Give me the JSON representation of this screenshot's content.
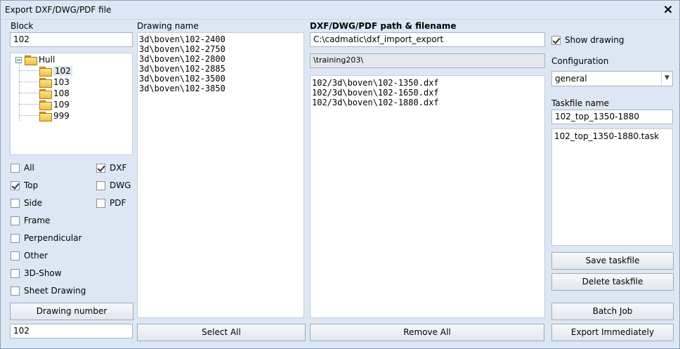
{
  "window": {
    "title": "Export DXF/DWG/PDF file",
    "close_label": "×"
  },
  "block": {
    "label": "Block",
    "value": "102",
    "tree": {
      "root": "Hull",
      "children": [
        "102",
        "103",
        "108",
        "109",
        "999"
      ]
    }
  },
  "filters": {
    "views": [
      {
        "label": "All",
        "checked": false
      },
      {
        "label": "Top",
        "checked": true
      },
      {
        "label": "Side",
        "checked": false
      },
      {
        "label": "Frame",
        "checked": false
      },
      {
        "label": "Perpendicular",
        "checked": false
      },
      {
        "label": "Other",
        "checked": false
      },
      {
        "label": "3D-Show",
        "checked": false
      },
      {
        "label": "Sheet Drawing",
        "checked": false
      }
    ],
    "formats": [
      {
        "label": "DXF",
        "checked": true
      },
      {
        "label": "DWG",
        "checked": false
      },
      {
        "label": "PDF",
        "checked": false
      }
    ]
  },
  "drawing_number": {
    "button_label": "Drawing number",
    "value": "102"
  },
  "drawing_name": {
    "label": "Drawing name",
    "items": [
      "3d\\boven\\102-2400",
      "3d\\boven\\102-2750",
      "3d\\boven\\102-2800",
      "3d\\boven\\102-2885",
      "3d\\boven\\102-3500",
      "3d\\boven\\102-3850"
    ],
    "select_all_label": "Select All"
  },
  "path": {
    "label": "DXF/DWG/PDF path & filename",
    "value": "C:\\cadmatic\\dxf_import_export",
    "subpath": "\\training203\\",
    "files": [
      "102/3d\\boven\\102-1350.dxf",
      "102/3d\\boven\\102-1650.dxf",
      "102/3d\\boven\\102-1880.dxf"
    ],
    "remove_all_label": "Remove All"
  },
  "right": {
    "show_drawing_label": "Show drawing",
    "show_drawing_checked": true,
    "configuration_label": "Configuration",
    "configuration_value": "general",
    "taskfile_label": "Taskfile name",
    "taskfile_value": "102_top_1350-1880",
    "taskfiles": [
      "102_top_1350-1880.task"
    ],
    "save_label": "Save taskfile",
    "delete_label": "Delete taskfile",
    "batch_label": "Batch Job",
    "export_label": "Export Immediately"
  }
}
